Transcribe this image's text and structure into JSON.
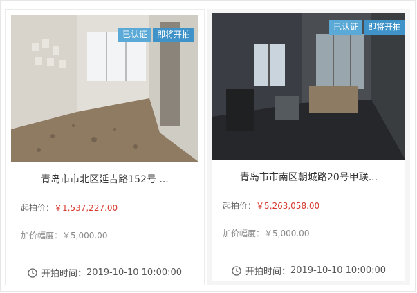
{
  "listings": [
    {
      "title": "青岛市市北区延吉路152号 ...",
      "badges": {
        "certified": "已认证",
        "status": "即将开拍"
      },
      "start_price_label": "起拍价：",
      "start_price": "￥1,537,227.00",
      "increment_label": "加价幅度：",
      "increment": "￥5,000.00",
      "start_time_label": "开拍时间：",
      "start_time": "2019-10-10 10:00:00"
    },
    {
      "title": "青岛市市南区朝城路20号甲联...",
      "badges": {
        "certified": "已认证",
        "status": "即将开拍"
      },
      "start_price_label": "起拍价：",
      "start_price": "￥5,263,058.00",
      "increment_label": "加价幅度：",
      "increment": "￥5,000.00",
      "start_time_label": "开拍时间：",
      "start_time": "2019-10-10 10:00:00"
    }
  ],
  "colors": {
    "badge_cert": "#5aa9d6",
    "badge_status": "#3f93c9",
    "price": "#d63a2f"
  },
  "icons": {
    "time": "clock-icon"
  }
}
